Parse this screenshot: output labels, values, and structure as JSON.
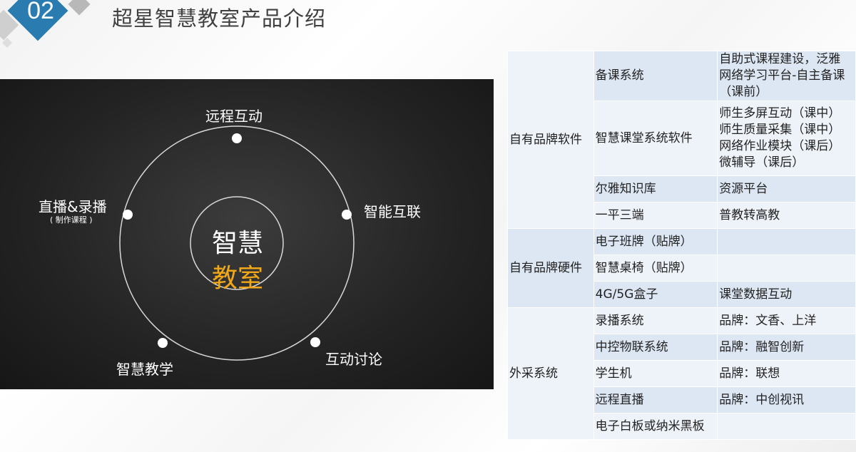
{
  "badge": "02",
  "title": "超星智慧教室产品介绍",
  "diagram": {
    "center_line1": "智慧",
    "center_line2": "教室",
    "nodes": {
      "top": "远程互动",
      "right": "智能互联",
      "bottom_right": "互动讨论",
      "bottom_left": "智慧教学",
      "left": "直播&录播",
      "left_sub": "( 制作课程 )"
    },
    "colors": {
      "accent": "#f0a818",
      "ring": "#d8d8d8"
    }
  },
  "table": {
    "groups": [
      {
        "name": "自有品牌软件",
        "rows": [
          {
            "item": "备课系统",
            "desc": [
              "自助式课程建设，泛雅",
              "网络学习平台-自主备课",
              "（课前）"
            ]
          },
          {
            "item": "智慧课堂系统软件",
            "desc": [
              "师生多屏互动（课中）",
              "师生质量采集（课中）",
              "网络作业模块（课后）",
              "微辅导（课后）"
            ]
          },
          {
            "item": "尔雅知识库",
            "desc": [
              "资源平台"
            ]
          },
          {
            "item": "一平三端",
            "desc": [
              "普教转高教"
            ]
          }
        ]
      },
      {
        "name": "自有品牌硬件",
        "rows": [
          {
            "item": "电子班牌（贴牌）",
            "desc": [
              ""
            ]
          },
          {
            "item": "智慧桌椅（贴牌）",
            "desc": [
              ""
            ]
          },
          {
            "item": "4G/5G盒子",
            "desc": [
              "课堂数据互动"
            ]
          }
        ]
      },
      {
        "name": "外采系统",
        "rows": [
          {
            "item": "录播系统",
            "desc": [
              "品牌：文香、上洋"
            ]
          },
          {
            "item": "中控物联系统",
            "desc": [
              "品牌：融智创新"
            ]
          },
          {
            "item": "学生机",
            "desc": [
              "品牌：联想"
            ]
          },
          {
            "item": "远程直播",
            "desc": [
              "品牌：中创视讯"
            ]
          },
          {
            "item": "电子白板或纳米黑板",
            "desc": [
              ""
            ]
          }
        ]
      }
    ]
  }
}
